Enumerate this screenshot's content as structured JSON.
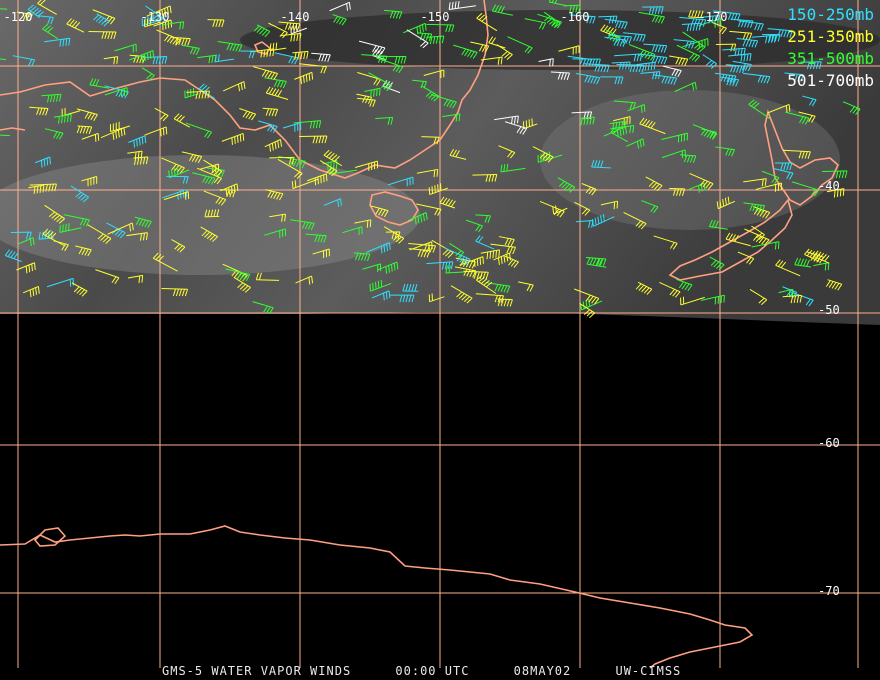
{
  "longitude_labels": [
    "-120",
    "-130",
    "-140",
    "-150",
    "-160",
    "-170"
  ],
  "latitude_labels": [
    "-40",
    "-50",
    "-60",
    "-70"
  ],
  "legend": [
    {
      "label": "150-250mb",
      "color": "#30e0ff"
    },
    {
      "label": "251-350mb",
      "color": "#ffff30"
    },
    {
      "label": "351-500mb",
      "color": "#30ff30"
    },
    {
      "label": "501-700mb",
      "color": "#ffffff"
    }
  ],
  "footer": {
    "satellite": "GMS-5 WATER VAPOR WINDS",
    "time": "00:00 UTC",
    "date": "08MAY02",
    "source": "UW-CIMSS"
  },
  "colors": {
    "coastline": "#ffa080",
    "grid": "#ffb090",
    "background": "#000000"
  }
}
